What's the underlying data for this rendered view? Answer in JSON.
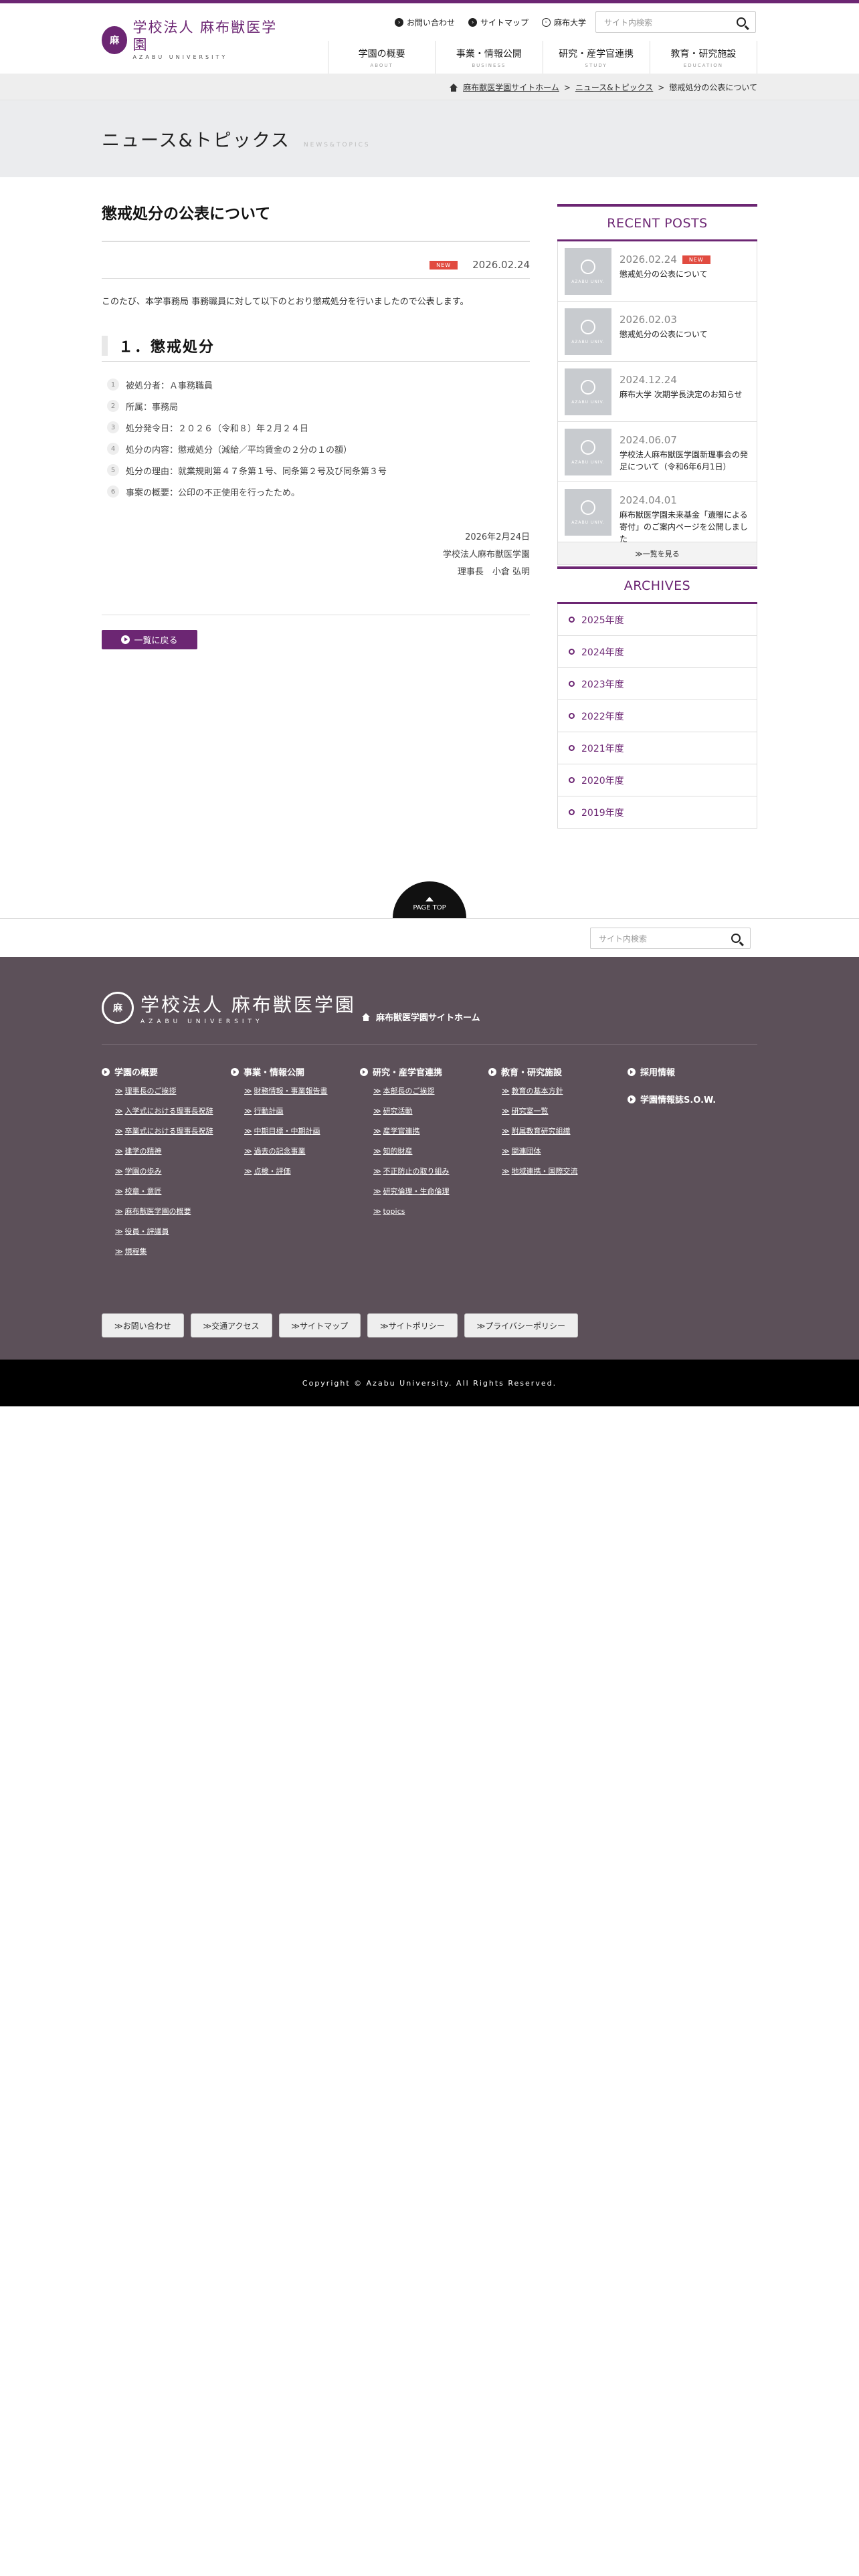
{
  "header": {
    "logo_jp": "学校法人 麻布獣医学園",
    "logo_en": "AZABU UNIVERSITY",
    "util_links": [
      "お問い合わせ",
      "サイトマップ",
      "麻布大学"
    ],
    "search_placeholder": "サイト内検索",
    "nav": [
      {
        "label": "学園の概要",
        "sub": "ABOUT"
      },
      {
        "label": "事業・情報公開",
        "sub": "BUSINESS"
      },
      {
        "label": "研究・産学官連携",
        "sub": "STUDY"
      },
      {
        "label": "教育・研究施設",
        "sub": "EDUCATION"
      }
    ]
  },
  "breadcrumb": [
    "麻布獣医学園サイトホーム",
    "ニュース&トピックス",
    "懲戒処分の公表について"
  ],
  "section": {
    "title": "ニュース&トピックス",
    "sub": "NEWS&TOPICS"
  },
  "article": {
    "title": "懲戒処分の公表について",
    "badge": "NEW",
    "date": "2026.02.24",
    "intro": "このたび、本学事務局 事務職員に対して以下のとおり懲戒処分を行いましたので公表します。",
    "h2": "１．懲戒処分",
    "items": [
      "被処分者：Ａ事務職員",
      "所属：事務局",
      "処分発令日：２０２６（令和８）年２月２４日",
      "処分の内容：懲戒処分（減給／平均賃金の２分の１の額）",
      "処分の理由：就業規則第４７条第１号、同条第２号及び同条第３号",
      "事案の概要：公印の不正使用を行ったため。"
    ],
    "signature": [
      "2026年2月24日",
      "学校法人麻布獣医学園",
      "理事長　小倉 弘明"
    ],
    "back_label": "一覧に戻る"
  },
  "sidebar": {
    "recent_heading": "RECENT POSTS",
    "thumb_label": "AZABU UNIV.",
    "posts": [
      {
        "date": "2026.02.24",
        "badge": "NEW",
        "title": "懲戒処分の公表について"
      },
      {
        "date": "2026.02.03",
        "badge": "",
        "title": "懲戒処分の公表について"
      },
      {
        "date": "2024.12.24",
        "badge": "",
        "title": "麻布大学 次期学長決定のお知らせ"
      },
      {
        "date": "2024.06.07",
        "badge": "",
        "title": "学校法人麻布獣医学園新理事会の発足について（令和6年6月1日）"
      },
      {
        "date": "2024.04.01",
        "badge": "",
        "title": "麻布獣医学園未来基金「遺贈による寄付」のご案内ページを公開しました"
      }
    ],
    "more_label": "≫一覧を見る",
    "archives_heading": "ARCHIVES",
    "archives": [
      "2025年度",
      "2024年度",
      "2023年度",
      "2022年度",
      "2021年度",
      "2020年度",
      "2019年度"
    ]
  },
  "page_top": "PAGE TOP",
  "footer": {
    "search_placeholder": "サイト内検索",
    "logo_jp": "学校法人 麻布獣医学園",
    "logo_en": "AZABU UNIVERSITY",
    "home_link": "麻布獣医学園サイトホーム",
    "columns": [
      {
        "heading": "学園の概要",
        "links": [
          "理事長のご挨拶",
          "入学式における理事長祝辞",
          "卒業式における理事長祝辞",
          "建学の精神",
          "学園の歩み",
          "校章・意匠",
          "麻布獣医学園の概要",
          "役員・評議員",
          "規程集"
        ]
      },
      {
        "heading": "事業・情報公開",
        "links": [
          "財務情報・事業報告書",
          "行動計画",
          "中期目標・中期計画",
          "過去の記念事業",
          "点検・評価"
        ]
      },
      {
        "heading": "研究・産学官連携",
        "links": [
          "本部長のご挨拶",
          "研究活動",
          "産学官連携",
          "知的財産",
          "不正防止の取り組み",
          "研究倫理・生命倫理",
          "topics"
        ]
      },
      {
        "heading": "教育・研究施設",
        "links": [
          "教育の基本方針",
          "研究室一覧",
          "附属教育研究組織",
          "関連団体",
          "地域連携・国際交流"
        ]
      },
      {
        "heading": "採用情報",
        "links": []
      }
    ],
    "extra_heading": "学園情報誌S.O.W.",
    "buttons": [
      "≫お問い合わせ",
      "≫交通アクセス",
      "≫サイトマップ",
      "≫サイトポリシー",
      "≫プライバシーポリシー"
    ],
    "copyright": "Copyright © Azabu University. All Rights Reserved."
  }
}
